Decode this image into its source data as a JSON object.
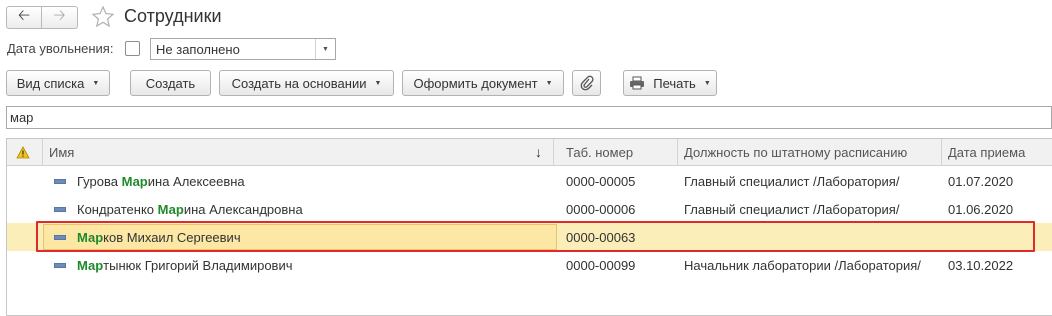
{
  "window": {
    "title": "Сотрудники"
  },
  "filter": {
    "label": "Дата увольнения:",
    "select_value": "Не заполнено"
  },
  "toolbar": {
    "view_list": "Вид списка",
    "create": "Создать",
    "create_based": "Создать на основании",
    "make_doc": "Оформить документ",
    "print": "Печать"
  },
  "search": {
    "value": "мар"
  },
  "table": {
    "columns": [
      "Имя",
      "Таб. номер",
      "Должность по штатному расписанию",
      "Дата приема"
    ],
    "rows": [
      {
        "name_match": "Мар",
        "name_before": "Гурова ",
        "name_after": "ина Алексеевна",
        "tab": "0000-00005",
        "position": "Главный специалист /Лаборатория/",
        "date": "01.07.2020"
      },
      {
        "name_match": "Мар",
        "name_before": "Кондратенко ",
        "name_after": "ина Александровна",
        "tab": "0000-00006",
        "position": "Главный специалист /Лаборатория/",
        "date": "01.06.2020"
      },
      {
        "name_match": "Мар",
        "name_before": "",
        "name_after": "ков Михаил Сергеевич",
        "tab": "0000-00063",
        "position": "",
        "date": ""
      },
      {
        "name_match": "Мар",
        "name_before": "",
        "name_after": "тынюк Григорий Владимирович",
        "tab": "0000-00099",
        "position": "Начальник лаборатории /Лаборатория/",
        "date": "03.10.2022"
      }
    ]
  },
  "colors": {
    "match_highlight": "#1e8a2a",
    "selected_row": "#fbeeb8",
    "annotation_frame": "#e02a2a"
  }
}
